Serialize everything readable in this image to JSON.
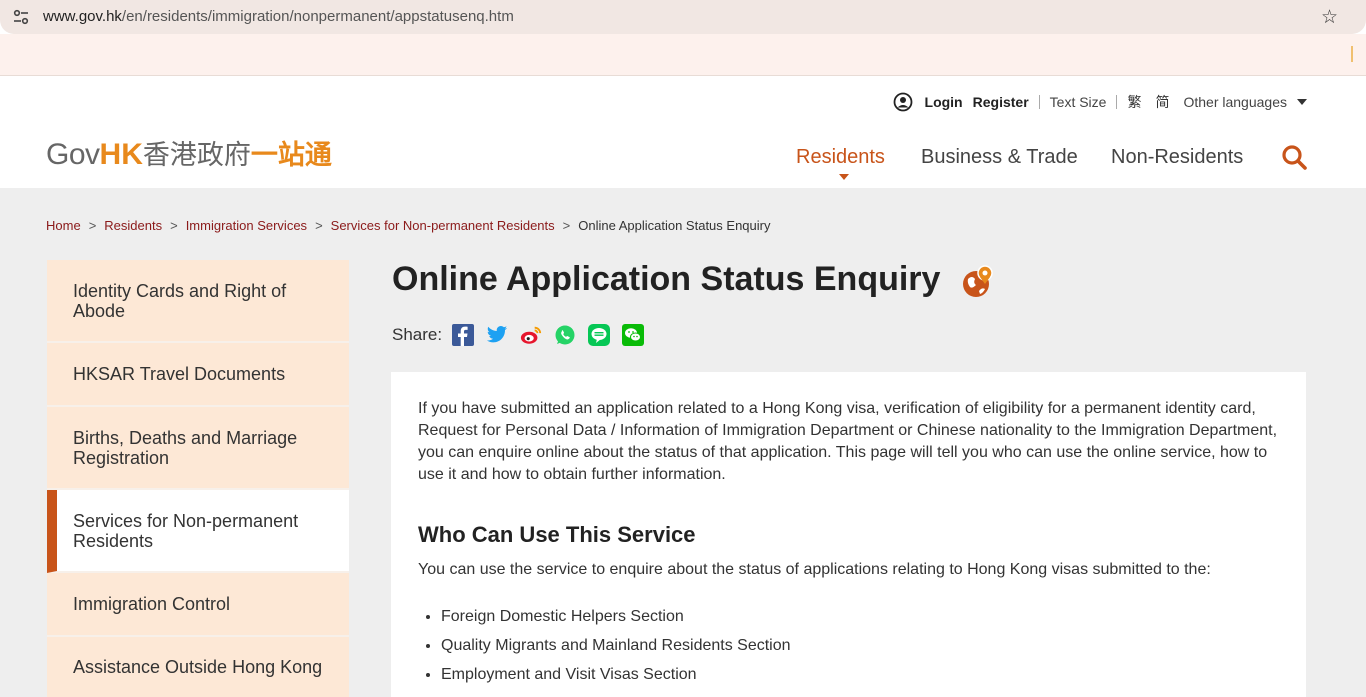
{
  "browser": {
    "url_host": "www.gov.hk",
    "url_path": "/en/residents/immigration/nonpermanent/appstatusenq.htm"
  },
  "header": {
    "login": "Login",
    "register": "Register",
    "text_size": "Text Size",
    "trad_chinese": "繁",
    "simp_chinese": "简",
    "other_languages": "Other languages",
    "logo_gov": "Gov",
    "logo_hk": "HK",
    "logo_cjk1": "香港政府",
    "logo_cjk2": "一站通",
    "nav": [
      "Residents",
      "Business & Trade",
      "Non-Residents"
    ]
  },
  "breadcrumb": [
    "Home",
    "Residents",
    "Immigration Services",
    "Services for Non-permanent Residents",
    "Online Application Status Enquiry"
  ],
  "breadcrumb_sep": ">",
  "sidebar": {
    "items": [
      "Identity Cards and Right of Abode",
      "HKSAR Travel Documents",
      "Births, Deaths and Marriage Registration",
      "Services for Non-permanent Residents",
      "Immigration Control",
      "Assistance Outside Hong Kong"
    ],
    "active_index": 3
  },
  "main": {
    "title": "Online Application Status Enquiry",
    "share_label": "Share:",
    "intro": "If you have submitted an application related to a Hong Kong visa, verification of eligibility for a permanent identity card, Request for Personal Data / Information of Immigration Department or Chinese nationality to the Immigration Department, you can enquire online about the status of that application. This page will tell you who can use the online service, how to use it and how to obtain further information.",
    "section_heading": "Who Can Use This Service",
    "section_lead": "You can use the service to enquire about the status of applications relating to Hong Kong visas submitted to the:",
    "bullets": [
      "Foreign Domestic Helpers Section",
      "Quality Migrants and Mainland Residents Section",
      "Employment and Visit Visas Section"
    ]
  },
  "colors": {
    "accent": "#c8541a",
    "logo_orange": "#e8891c",
    "breadcrumb_link": "#8b1a1a",
    "sidebar_bg": "#fde8d6",
    "content_bg": "#eeeeee"
  }
}
